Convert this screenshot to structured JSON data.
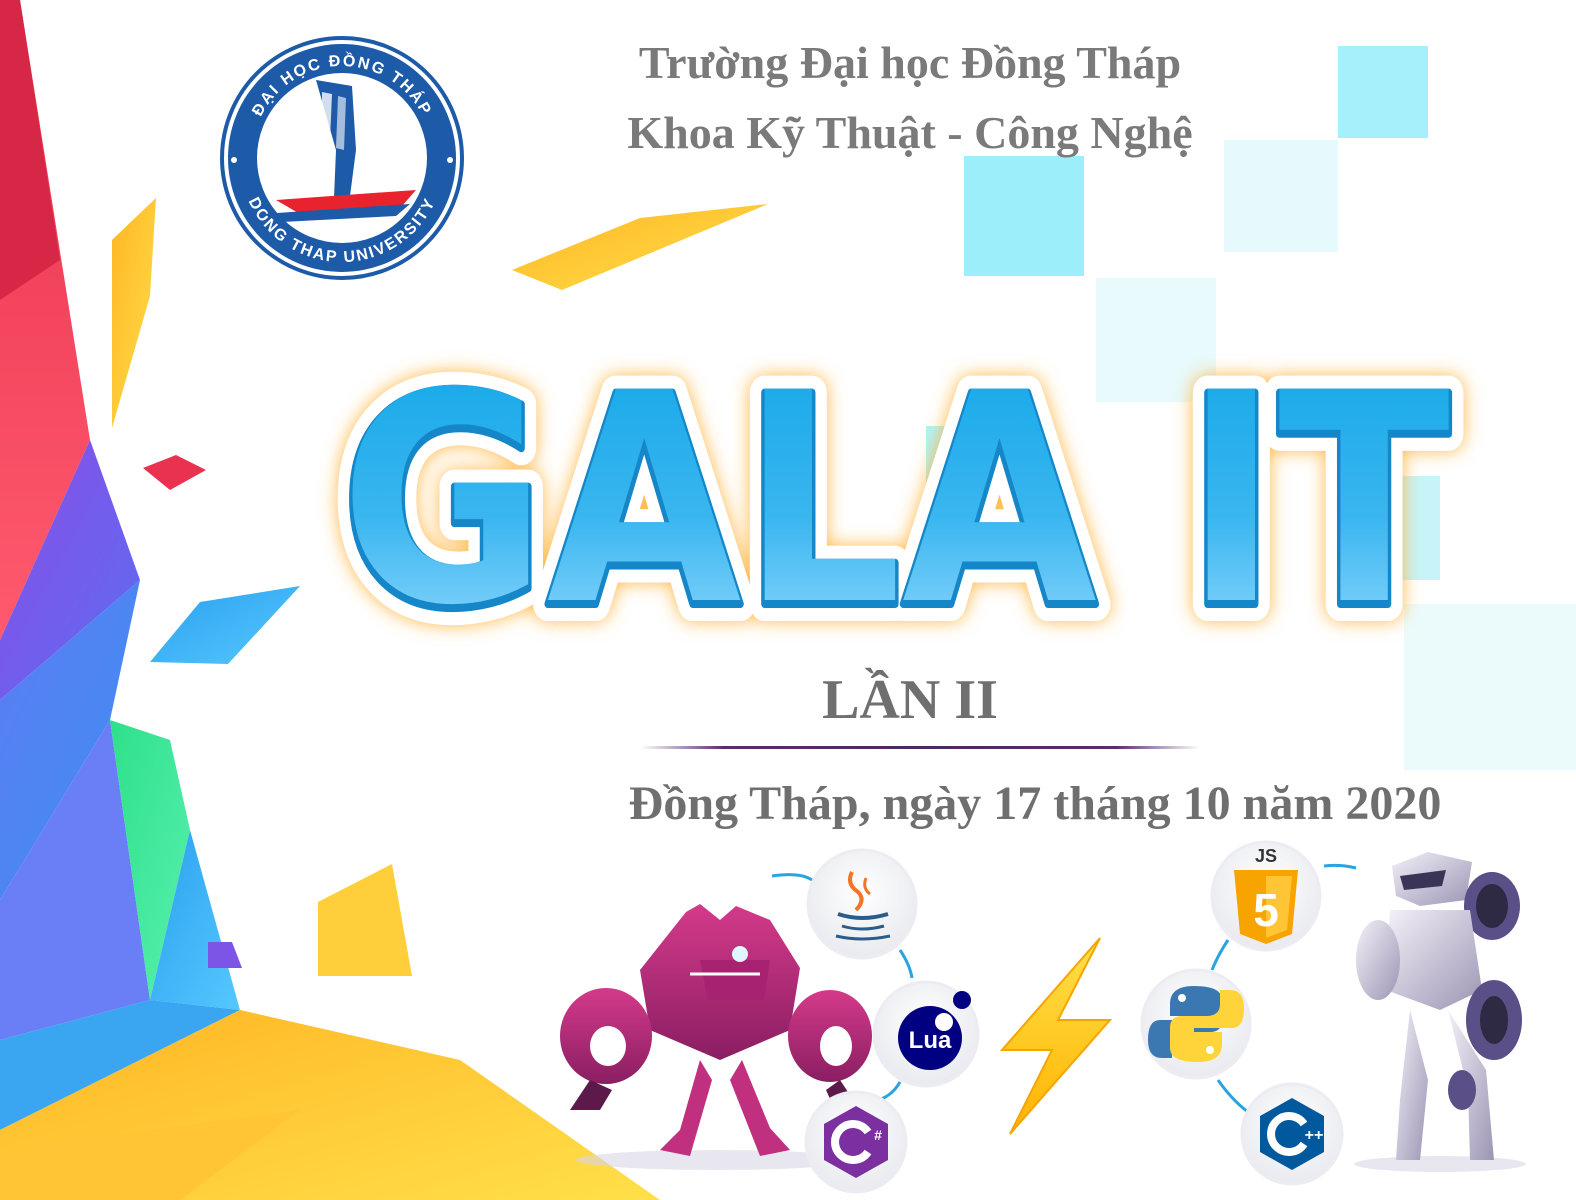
{
  "logo": {
    "top_text": "ĐẠI HỌC ĐỒNG THÁP",
    "bottom_text": "DONG THAP UNIVERSITY"
  },
  "header": {
    "university": "Trường Đại học Đồng Tháp",
    "faculty": "Khoa Kỹ Thuật - Công Nghệ"
  },
  "title": "GALA IT",
  "edition": "LẦN II",
  "date_line": "Đồng Tháp, ngày 17 tháng 10 năm 2020",
  "tech_badges": {
    "js": "JS",
    "html5": "5",
    "lua": "Lua",
    "csharp": "#",
    "cpp": "++"
  },
  "icons": [
    "java-icon",
    "lua-icon",
    "csharp-icon",
    "html5-icon",
    "python-icon",
    "cpp-icon",
    "lightning-icon"
  ],
  "colors": {
    "title_blue": "#1ea3e4",
    "title_glow": "#ffb030",
    "text_gray": "#7a7a7a",
    "logo_blue": "#1d5aa8"
  }
}
